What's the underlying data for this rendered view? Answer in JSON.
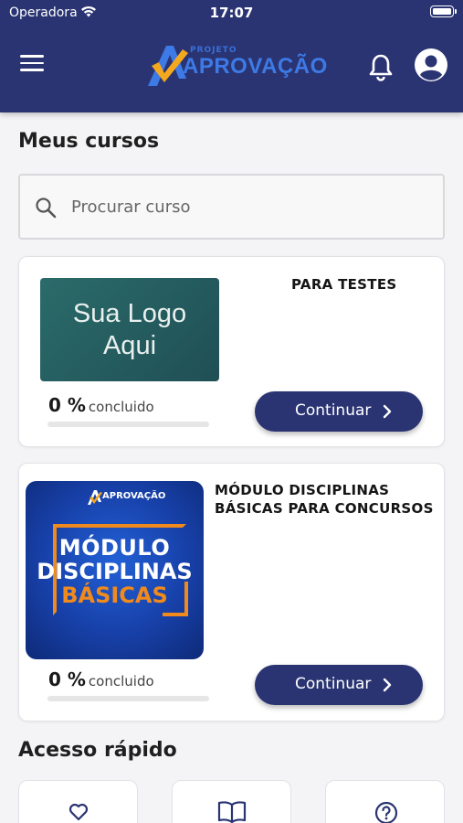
{
  "status_bar": {
    "carrier": "Operadora",
    "time": "17:07"
  },
  "header": {
    "logo_small": "PROJETO",
    "logo_main": "APROVAÇÃO",
    "menu_icon": "menu-icon",
    "notification_icon": "bell-icon",
    "account_icon": "account-circle-icon",
    "color": "#2a3472"
  },
  "courses_section": {
    "title": "Meus cursos"
  },
  "search": {
    "placeholder": "Procurar curso",
    "value": ""
  },
  "courses": [
    {
      "title": "PARA TESTES",
      "thumbnail_text_line1": "Sua Logo",
      "thumbnail_text_line2": "Aqui",
      "progress_value": "0 %",
      "progress_label": "concluido",
      "progress": 0,
      "button_label": "Continuar"
    },
    {
      "title_line1": "MÓDULO DISCIPLINAS",
      "title_line2": "BÁSICAS PARA CONCURSOS",
      "thumbnail_brand": "APROVAÇÃO",
      "thumbnail_line1": "MÓDULO",
      "thumbnail_line2": "DISCIPLINAS",
      "thumbnail_line3": "BÁSICAS",
      "progress_value": "0 %",
      "progress_label": "concluido",
      "progress": 0,
      "button_label": "Continuar"
    }
  ],
  "quick_access": {
    "title": "Acesso rápido",
    "items": [
      {
        "icon": "heart-icon"
      },
      {
        "icon": "book-open-icon"
      },
      {
        "icon": "help-circle-icon"
      }
    ]
  },
  "colors": {
    "primary": "#2a3472",
    "accent_orange": "#f08a1c",
    "background": "#f4f4f6"
  }
}
